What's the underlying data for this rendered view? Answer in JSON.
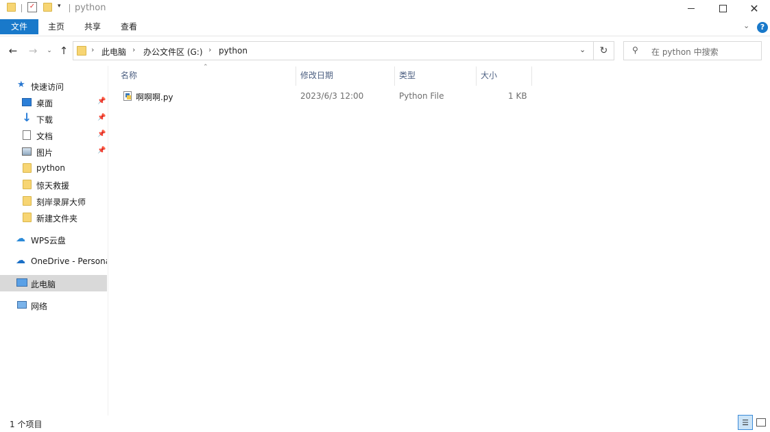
{
  "window": {
    "title": "python"
  },
  "ribbon": {
    "tabs": [
      {
        "label": "文件"
      },
      {
        "label": "主页"
      },
      {
        "label": "共享"
      },
      {
        "label": "查看"
      }
    ]
  },
  "address": {
    "crumbs": [
      "此电脑",
      "办公文件区 (G:)",
      "python"
    ]
  },
  "search": {
    "placeholder": "在 python 中搜索"
  },
  "sidebar": {
    "quick_access": "快速访问",
    "items": [
      {
        "label": "桌面",
        "icon": "desktop-icon",
        "pinned": true
      },
      {
        "label": "下载",
        "icon": "download-icon",
        "pinned": true
      },
      {
        "label": "文档",
        "icon": "document-icon",
        "pinned": true
      },
      {
        "label": "图片",
        "icon": "picture-icon",
        "pinned": true
      },
      {
        "label": "python",
        "icon": "folder-icon",
        "pinned": false
      },
      {
        "label": "惊天救援",
        "icon": "folder-icon",
        "pinned": false
      },
      {
        "label": "刻岸录屏大师",
        "icon": "folder-icon",
        "pinned": false
      },
      {
        "label": "新建文件夹",
        "icon": "folder-icon",
        "pinned": false
      }
    ],
    "wps": "WPS云盘",
    "onedrive": "OneDrive - Persona",
    "this_pc": "此电脑",
    "network": "网络"
  },
  "filelist": {
    "columns": {
      "name": "名称",
      "modified": "修改日期",
      "type": "类型",
      "size": "大小"
    },
    "rows": [
      {
        "name": "啊啊啊.py",
        "modified": "2023/6/3 12:00",
        "type": "Python File",
        "size": "1 KB"
      }
    ]
  },
  "status": {
    "count": "1 个项目"
  },
  "colors": {
    "accent": "#1979ca",
    "selected_bg": "#d9d9d9",
    "header_text": "#4d6082"
  }
}
